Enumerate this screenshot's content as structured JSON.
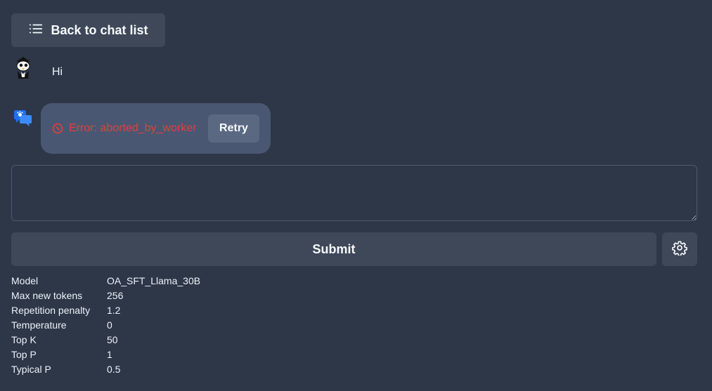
{
  "nav": {
    "back_label": "Back to chat list",
    "back_icon": "list-icon"
  },
  "messages": {
    "user": {
      "text": "Hi",
      "avatar": "user-avatar"
    },
    "assistant": {
      "error_text": "Error: aborted_by_worker",
      "error_icon": "warning-circle-icon",
      "retry_label": "Retry",
      "avatar": "assistant-avatar"
    }
  },
  "composer": {
    "value": "",
    "placeholder": "",
    "submit_label": "Submit",
    "settings_icon": "gear-icon"
  },
  "params": [
    {
      "key": "Model",
      "value": "OA_SFT_Llama_30B"
    },
    {
      "key": "Max new tokens",
      "value": "256"
    },
    {
      "key": "Repetition penalty",
      "value": "1.2"
    },
    {
      "key": "Temperature",
      "value": "0"
    },
    {
      "key": "Top K",
      "value": "50"
    },
    {
      "key": "Top P",
      "value": "1"
    },
    {
      "key": "Typical P",
      "value": "0.5"
    }
  ],
  "colors": {
    "background": "#2d3748",
    "button": "#3e4859",
    "bubble": "#4a5772",
    "error": "#e53e3e",
    "assistant_icon": "#1e6ff0"
  }
}
